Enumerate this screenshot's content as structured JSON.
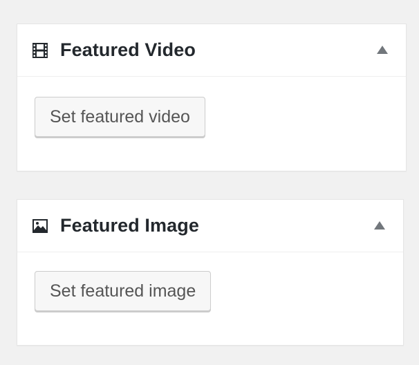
{
  "featured_video": {
    "title": "Featured Video",
    "icon": "film-icon",
    "button_label": "Set featured video"
  },
  "featured_image": {
    "title": "Featured Image",
    "icon": "image-icon",
    "button_label": "Set featured image"
  },
  "colors": {
    "background": "#f1f1f1",
    "panel": "#ffffff",
    "title_text": "#23282d",
    "button_text": "#555555",
    "button_bg": "#f7f7f7",
    "toggle_arrow": "#72777c"
  }
}
